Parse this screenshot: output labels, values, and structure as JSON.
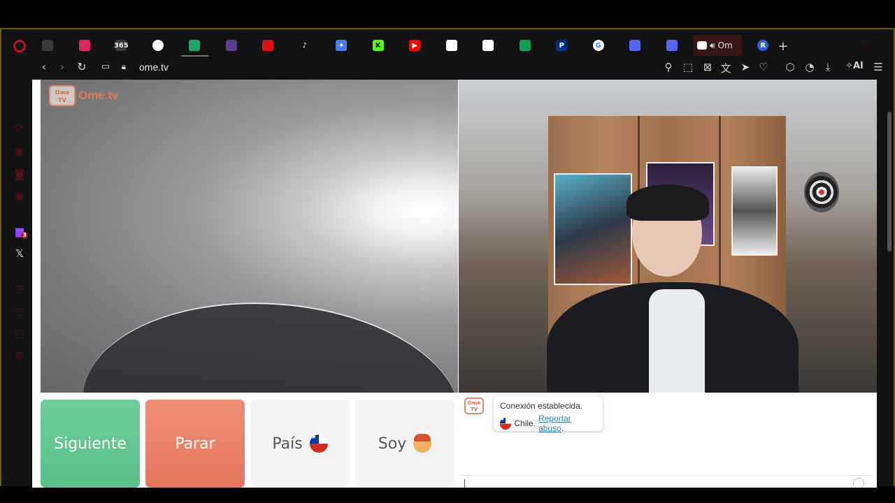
{
  "browser": {
    "tabs": [
      {
        "icon": "gamepad-icon",
        "label": ""
      },
      {
        "icon": "tinder-icon",
        "label": ""
      },
      {
        "icon": "365-icon",
        "label": "365"
      },
      {
        "icon": "star-circle-icon",
        "label": ""
      },
      {
        "icon": "google-drive-icon",
        "label": ""
      },
      {
        "icon": "globe-icon",
        "label": ""
      },
      {
        "icon": "red-circle-icon",
        "label": ""
      },
      {
        "icon": "tiktok-icon",
        "label": "♪"
      },
      {
        "icon": "gemini-icon",
        "label": "✦"
      },
      {
        "icon": "kick-icon",
        "label": "K"
      },
      {
        "icon": "youtube-icon",
        "label": "▶"
      },
      {
        "icon": "github-icon",
        "label": ""
      },
      {
        "icon": "github-icon",
        "label": ""
      },
      {
        "icon": "sheets-icon",
        "label": ""
      },
      {
        "icon": "paypal-icon",
        "label": "P"
      },
      {
        "icon": "google-icon",
        "label": "G"
      },
      {
        "icon": "discord-icon",
        "label": ""
      },
      {
        "icon": "discord-icon",
        "label": ""
      }
    ],
    "active_tab_label": "Om",
    "extra_tab_letter": "R",
    "url": "ome.tv",
    "ai_label": "AI",
    "twitch_badge": "3"
  },
  "app": {
    "logo_badge_top": "Ome",
    "logo_badge_bottom": "TV",
    "logo_text": "Ome.tv"
  },
  "controls": {
    "next_label": "Siguiente",
    "stop_label": "Parar",
    "country_label": "País",
    "gender_label": "Soy"
  },
  "chat": {
    "status_text": "Conexión establecida.",
    "country_text": "Chile.",
    "report_label": "Reportar abuso",
    "report_suffix": "."
  },
  "colors": {
    "next_green": "#5fc38e",
    "stop_red": "#e97b62",
    "brand_orange": "#e07a55",
    "frame_gold": "#6e5c12"
  }
}
